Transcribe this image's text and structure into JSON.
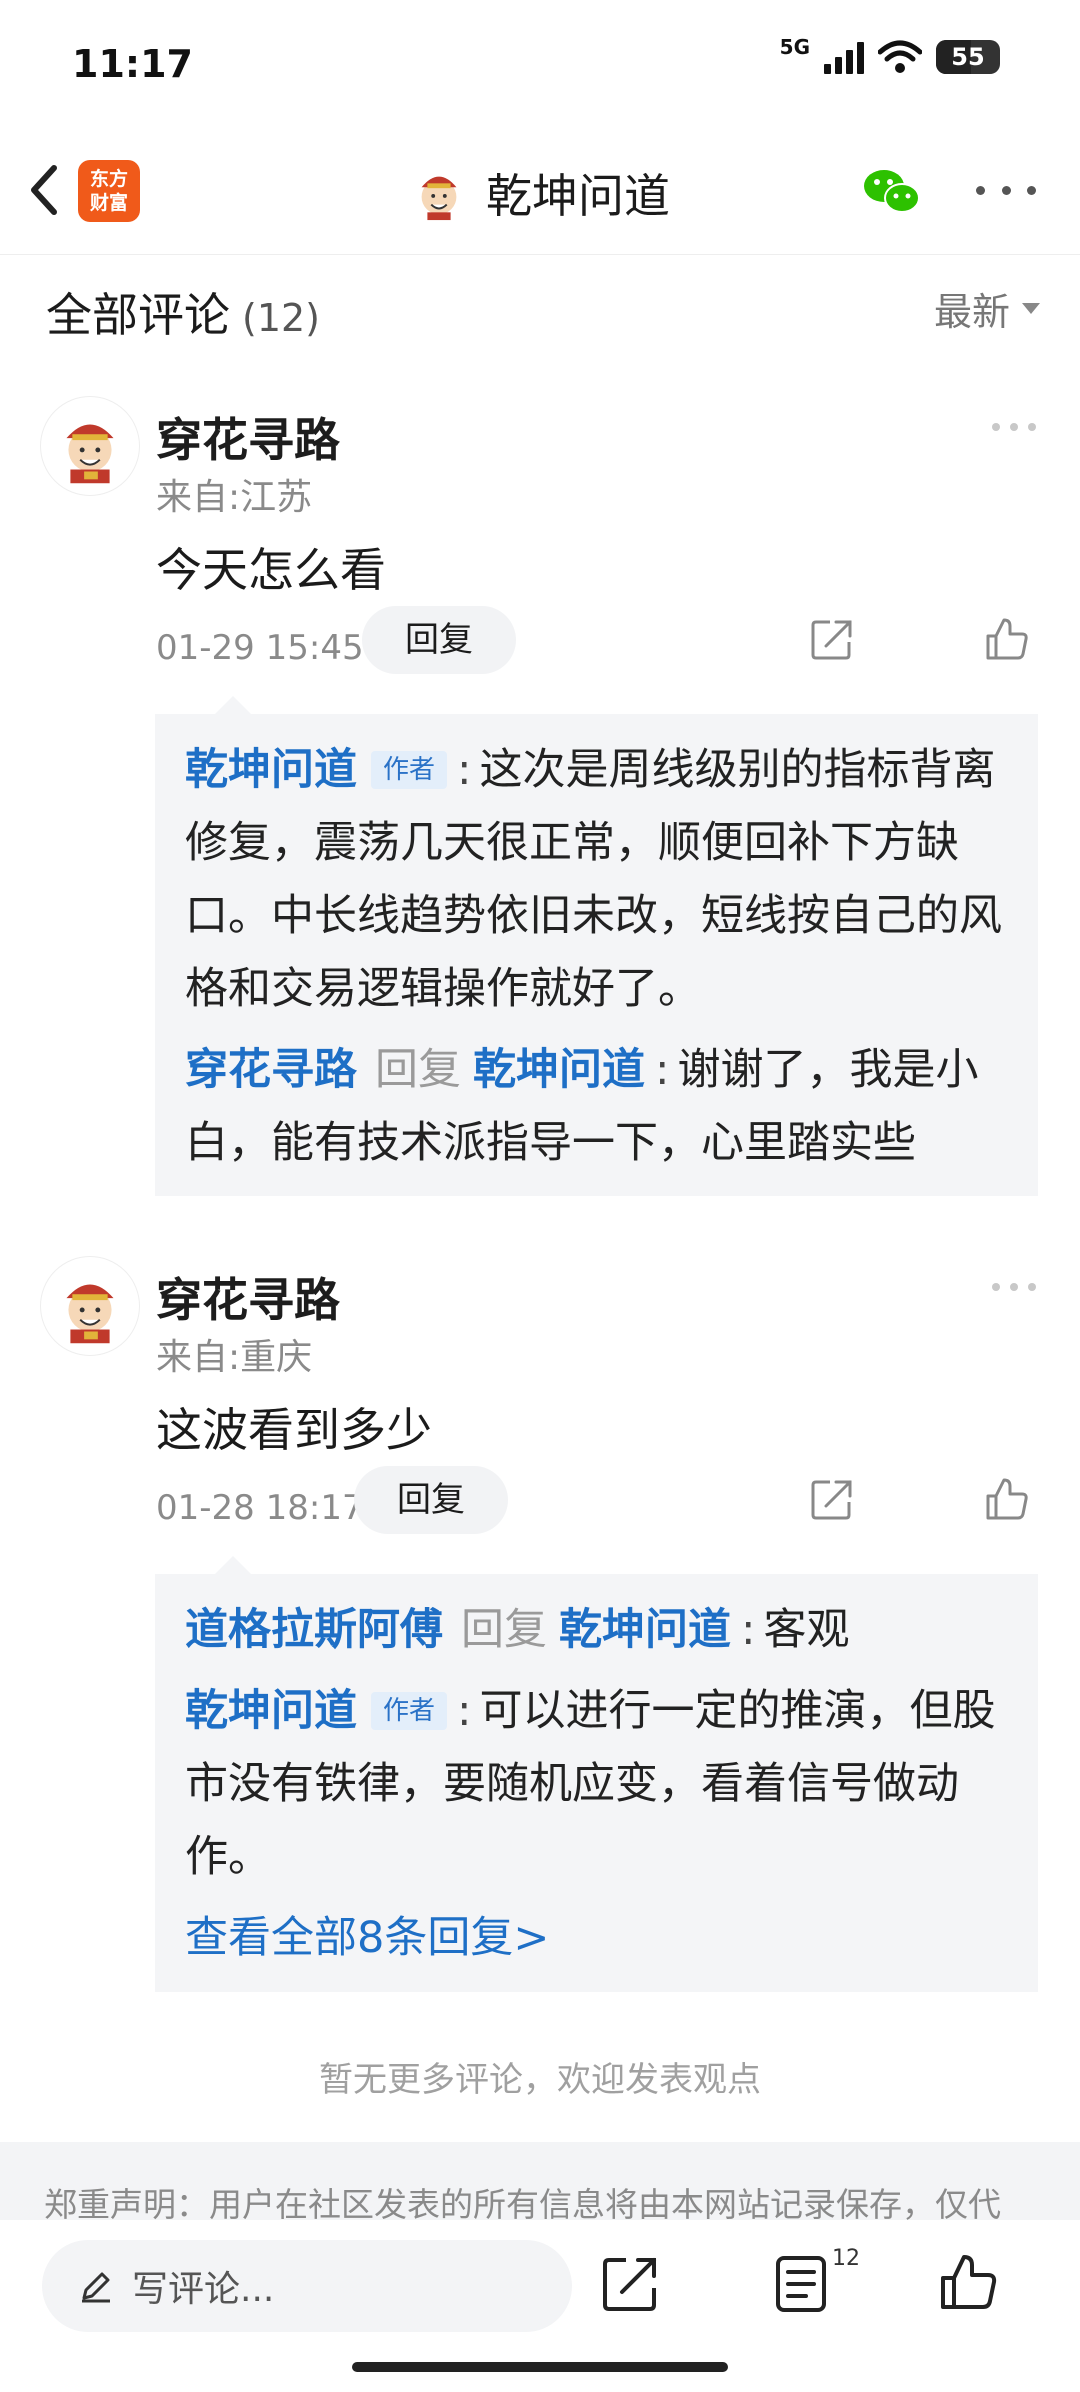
{
  "status": {
    "time": "11:17",
    "network": "5G",
    "battery": "55",
    "battery_level": 0.55
  },
  "header": {
    "title": "乾坤问道",
    "app_logo": "东方财富",
    "icons": [
      "back-icon",
      "wechat-icon",
      "more-icon"
    ]
  },
  "comments_header": {
    "title": "全部评论",
    "count": "(12)",
    "sort": "最新"
  },
  "comments": [
    {
      "name": "穿花寻路",
      "location": "来自:江苏",
      "text": "今天怎么看",
      "time": "01-29 15:45",
      "reply_label": "回复",
      "replies": [
        {
          "name": "乾坤问道",
          "author_tag": "作者",
          "text": "这次是周线级别的指标背离修复，震荡几天很正常，顺便回补下方缺口。中长线趋势依旧未改，短线按自己的风格和交易逻辑操作就好了。"
        },
        {
          "name": "穿花寻路",
          "verb": "回复",
          "target": "乾坤问道",
          "text": "谢谢了，我是小白，能有技术派指导一下，心里踏实些"
        }
      ]
    },
    {
      "name": "穿花寻路",
      "location": "来自:重庆",
      "text": "这波看到多少",
      "time": "01-28 18:17",
      "reply_label": "回复",
      "replies": [
        {
          "name": "道格拉斯阿傅",
          "verb": "回复",
          "target": "乾坤问道",
          "text": "客观"
        },
        {
          "name": "乾坤问道",
          "author_tag": "作者",
          "text": "可以进行一定的推演，但股市没有铁律，要随机应变，看着信号做动作。"
        }
      ],
      "view_all": "查看全部8条回复>"
    }
  ],
  "no_more": "暂无更多评论，欢迎发表观点",
  "disclaimer": "郑重声明：用户在社区发表的所有信息将由本网站记录保存，仅代",
  "bottom_bar": {
    "placeholder": "写评论...",
    "comment_count": "12"
  },
  "colors": {
    "link_blue": "#1e6fc6",
    "brand_orange": "#f05a1a",
    "wechat_green": "#2dc100"
  }
}
